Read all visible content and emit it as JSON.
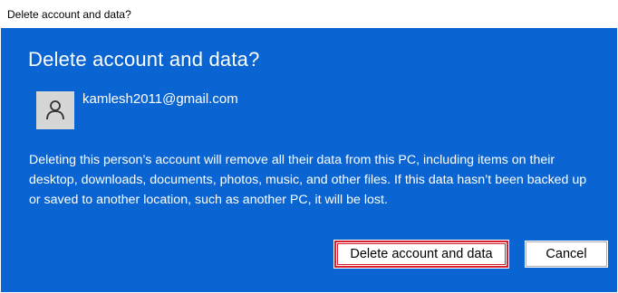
{
  "window": {
    "title": "Delete account and data?"
  },
  "dialog": {
    "heading": "Delete account and data?",
    "account": {
      "email": "kamlesh2011@gmail.com",
      "avatar_icon": "person-icon"
    },
    "description": "Deleting this person’s account will remove all their data from this PC, including items on their desktop, downloads, documents, photos, music, and other files. If this data hasn’t been backed up or saved to another location, such as another PC, it will be lost.",
    "buttons": {
      "delete_label": "Delete account and data",
      "cancel_label": "Cancel"
    }
  },
  "colors": {
    "dialog_background": "#0a64d2",
    "focus_border": "#d9202f",
    "button_background": "#ffffff"
  }
}
